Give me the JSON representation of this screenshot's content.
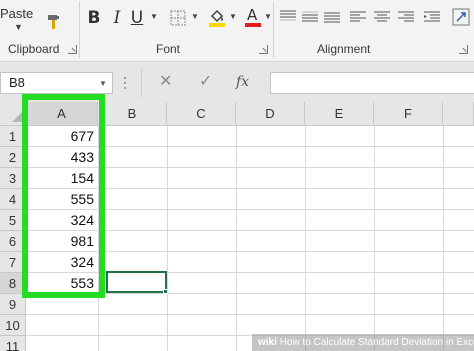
{
  "ribbon": {
    "paste_label": "Paste",
    "clipboard_label": "Clipboard",
    "font_label": "Font",
    "alignment_label": "Alignment",
    "bold_label": "B",
    "italic_label": "I",
    "underline_label": "U"
  },
  "formula_bar": {
    "name_box": "B8",
    "cancel_label": "✕",
    "enter_label": "✓",
    "fx_label": "fx",
    "formula": ""
  },
  "grid": {
    "columns": [
      "A",
      "B",
      "C",
      "D",
      "E",
      "F"
    ],
    "rows": [
      "1",
      "2",
      "3",
      "4",
      "5",
      "6",
      "7",
      "8",
      "9",
      "10",
      "11"
    ],
    "column_a_values": [
      "677",
      "433",
      "154",
      "555",
      "324",
      "981",
      "324",
      "553"
    ],
    "active_cell": "B8"
  },
  "colors": {
    "highlight_green": "#22dd22",
    "excel_green": "#217346",
    "fill_yellow": "#ffd700",
    "font_red": "#e02020"
  },
  "watermark": {
    "brand": "wiki",
    "text": "How to Calculate Standard Deviation in Excel"
  }
}
